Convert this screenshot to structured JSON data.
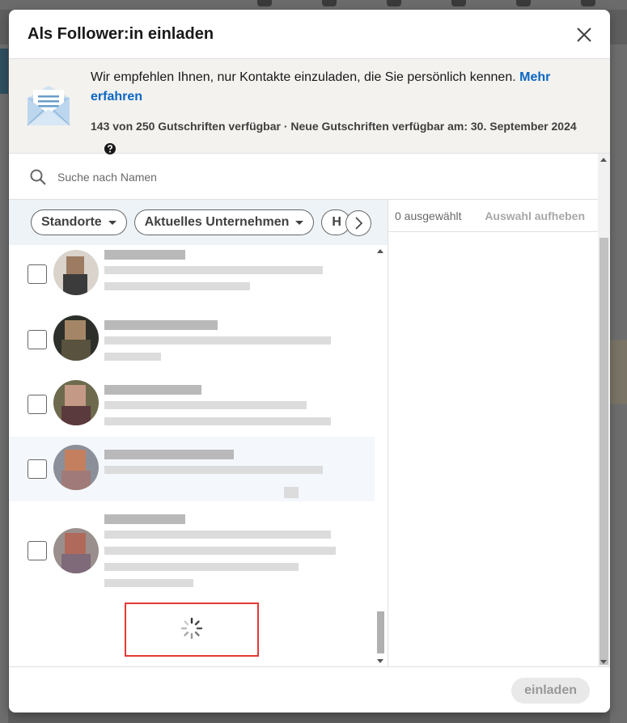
{
  "dialog": {
    "title": "Als Follower:in einladen",
    "close_label": "Schließen"
  },
  "banner": {
    "message": "Wir empfehlen Ihnen, nur Kontakte einzuladen, die Sie persönlich kennen.",
    "link_text": "Mehr erfahren",
    "credits": "143 von 250 Gutschriften verfügbar · Neue Gutschriften verfügbar am: 30. September 2024"
  },
  "search": {
    "placeholder": "Suche nach Namen",
    "value": ""
  },
  "filters": [
    {
      "label": "Standorte"
    },
    {
      "label": "Aktuelles Unternehmen"
    },
    {
      "label": "H"
    }
  ],
  "selection": {
    "count_text": "0 ausgewählt",
    "clear_label": "Auswahl aufheben"
  },
  "footer": {
    "invite_label": "einladen"
  },
  "colors": {
    "accent": "#0a66c2",
    "highlight": "#e53935",
    "filter_bg": "#eef3f8"
  },
  "icons": {
    "close": "close-icon",
    "search": "search-icon",
    "help": "help-icon",
    "envelope": "envelope-icon",
    "next": "chevron-right-icon",
    "loading": "spinner-icon"
  }
}
